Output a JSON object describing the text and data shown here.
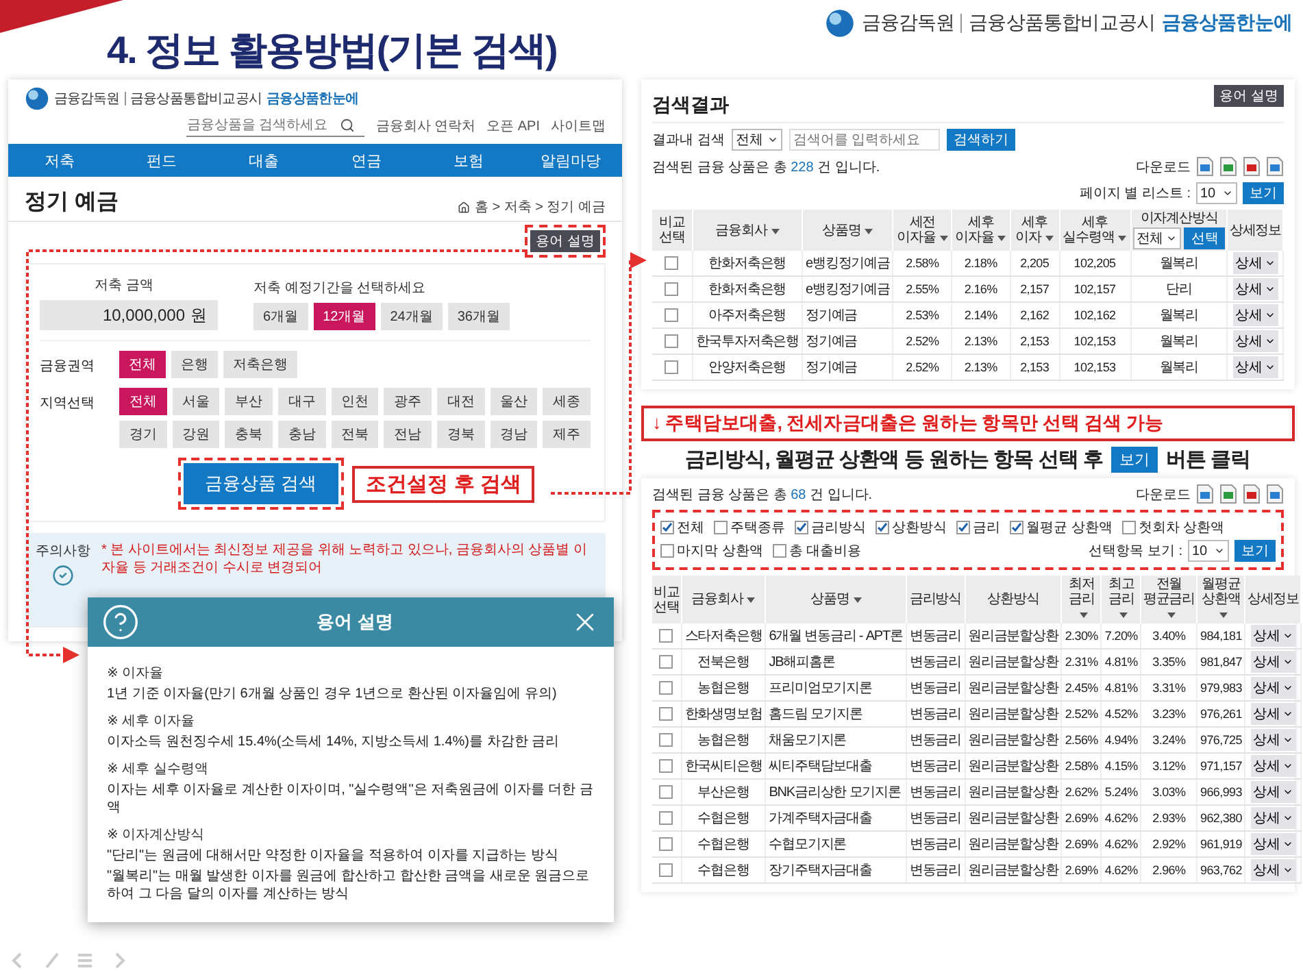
{
  "slide": {
    "title": "4. 정보 활용방법(기본 검색)"
  },
  "brand": {
    "agency": "금융감독원",
    "service": "금융상품통합비교공시",
    "site": "금융상품한눈에"
  },
  "page": {
    "brand": {
      "agency": "금융감독원",
      "service": "금융상품통합비교공시",
      "site": "금융상품한눈에"
    },
    "search": {
      "placeholder": "금융상품을 검색하세요"
    },
    "links": [
      "금융회사 연락처",
      "오픈 API",
      "사이트맵"
    ],
    "nav": [
      "저축",
      "펀드",
      "대출",
      "연금",
      "보험",
      "알림마당"
    ],
    "title": "정기 예금",
    "breadcrumb": "홈 > 저축 > 정기 예금",
    "glossary_button": {
      "label": "용어 설명",
      "highlighted": true
    },
    "amount": {
      "label": "저축 금액",
      "value": "10,000,000",
      "unit": "원"
    },
    "period": {
      "label": "저축 예정기간을 선택하세요",
      "options": [
        {
          "label": "6개월",
          "selected": false
        },
        {
          "label": "12개월",
          "selected": true
        },
        {
          "label": "24개월",
          "selected": false
        },
        {
          "label": "36개월",
          "selected": false
        }
      ]
    },
    "sector": {
      "label": "금융권역",
      "options": [
        {
          "label": "전체",
          "selected": true
        },
        {
          "label": "은행",
          "selected": false
        },
        {
          "label": "저축은행",
          "selected": false
        }
      ]
    },
    "region": {
      "label": "지역선택",
      "options": [
        {
          "label": "전체",
          "selected": true
        },
        {
          "label": "서울",
          "selected": false
        },
        {
          "label": "부산",
          "selected": false
        },
        {
          "label": "대구",
          "selected": false
        },
        {
          "label": "인천",
          "selected": false
        },
        {
          "label": "광주",
          "selected": false
        },
        {
          "label": "대전",
          "selected": false
        },
        {
          "label": "울산",
          "selected": false
        },
        {
          "label": "세종",
          "selected": false
        },
        {
          "label": "경기",
          "selected": false
        },
        {
          "label": "강원",
          "selected": false
        },
        {
          "label": "충북",
          "selected": false
        },
        {
          "label": "충남",
          "selected": false
        },
        {
          "label": "전북",
          "selected": false
        },
        {
          "label": "전남",
          "selected": false
        },
        {
          "label": "경북",
          "selected": false
        },
        {
          "label": "경남",
          "selected": false
        },
        {
          "label": "제주",
          "selected": false
        }
      ]
    },
    "search_button": {
      "label": "금융상품 검색",
      "highlighted": true
    },
    "notice": {
      "label": "주의사항",
      "text": "* 본 사이트에서는 최신정보 제공을 위해 노력하고 있으나, 금융회사의 상품별 이자율 등 거래조건이 수시로 변경되어"
    }
  },
  "search_callout": "조건설정 후 검색",
  "glossary_dialog": {
    "title": "용어 설명",
    "sections": [
      {
        "heading": "※ 이자율",
        "lines": [
          "1년 기준 이자율(만기 6개월 상품인 경우 1년으로 환산된 이자율임에 유의)"
        ]
      },
      {
        "heading": "※ 세후 이자율",
        "lines": [
          "이자소득 원천징수세 15.4%(소득세 14%, 지방소득세 1.4%)를 차감한 금리"
        ]
      },
      {
        "heading": "※ 세후 실수령액",
        "lines": [
          "이자는 세후 이자율로 계산한 이자이며, \"실수령액\"은 저축원금에 이자를 더한 금액"
        ]
      },
      {
        "heading": "※ 이자계산방식",
        "lines": [
          "\"단리\"는 원금에 대해서만 약정한 이자율을 적용하여 이자를 지급하는 방식",
          "\"월복리\"는 매월 발생한 이자를 원금에 합산하고 합산한 금액을 새로운 원금으로 하여 그 다음 달의 이자를 계산하는 방식"
        ]
      }
    ]
  },
  "results": {
    "title": "검색결과",
    "glossary_button": "용어 설명",
    "filter_label": "결과내 검색",
    "scope": "전체",
    "placeholder": "검색어를 입력하세요",
    "search_button": "검색하기",
    "count": {
      "before": "검색된 금융 상품은 총",
      "number": "228",
      "after": "건 입니다."
    },
    "download": "다운로드",
    "page_size": {
      "label": "페이지 별 리스트 :",
      "value": "10",
      "button": "보기"
    },
    "table": {
      "columns": [
        {
          "label": "비교 선택",
          "kind": "check",
          "sortable": false
        },
        {
          "label": "금융회사",
          "kind": "text",
          "sortable": true
        },
        {
          "label": "상품명",
          "kind": "text",
          "sortable": true
        },
        {
          "label": "세전 이자율",
          "kind": "number",
          "sortable": true
        },
        {
          "label": "세후 이자율",
          "kind": "number",
          "sortable": true
        },
        {
          "label": "세후 이자",
          "kind": "number",
          "sortable": true
        },
        {
          "label": "세후 실수령액",
          "kind": "number",
          "sortable": true
        },
        {
          "label": "이자계산방식",
          "kind": "text",
          "sortable": false,
          "filter": {
            "value": "전체",
            "button": "선택"
          }
        },
        {
          "label": "상세정보",
          "kind": "detail",
          "sortable": false
        }
      ],
      "rows": [
        {
          "checked": false,
          "cells": [
            "",
            "한화저축은행",
            "e뱅킹정기예금",
            "2.58%",
            "2.18%",
            "2,205",
            "102,205",
            "월복리",
            "상세"
          ]
        },
        {
          "checked": false,
          "cells": [
            "",
            "한화저축은행",
            "e뱅킹정기예금",
            "2.55%",
            "2.16%",
            "2,157",
            "102,157",
            "단리",
            "상세"
          ]
        },
        {
          "checked": false,
          "cells": [
            "",
            "아주저축은행",
            "정기예금",
            "2.53%",
            "2.14%",
            "2,162",
            "102,162",
            "월복리",
            "상세"
          ]
        },
        {
          "checked": false,
          "cells": [
            "",
            "한국투자저축은행",
            "정기예금",
            "2.52%",
            "2.13%",
            "2,153",
            "102,153",
            "월복리",
            "상세"
          ]
        },
        {
          "checked": false,
          "cells": [
            "",
            "안양저축은행",
            "정기예금",
            "2.52%",
            "2.13%",
            "2,153",
            "102,153",
            "월복리",
            "상세"
          ]
        }
      ]
    }
  },
  "loan_callout": "↓ 주택담보대출, 전세자금대출은 원하는 항목만 선택 검색 가능",
  "loan_hint": {
    "before": "금리방식, 월평균 상환액 등 원하는 항목 선택 후",
    "button": "보기",
    "after": "버튼 클릭"
  },
  "loan_results": {
    "count": {
      "before": "검색된 금융 상품은 총",
      "number": "68",
      "after": "건 입니다."
    },
    "download": "다운로드",
    "filters": {
      "highlighted": true,
      "options": [
        {
          "label": "전체",
          "checked": true
        },
        {
          "label": "주택종류",
          "checked": false
        },
        {
          "label": "금리방식",
          "checked": true
        },
        {
          "label": "상환방식",
          "checked": true
        },
        {
          "label": "금리",
          "checked": true
        },
        {
          "label": "월평균 상환액",
          "checked": true
        },
        {
          "label": "첫회차 상환액",
          "checked": false
        },
        {
          "label": "마지막 상환액",
          "checked": false
        },
        {
          "label": "총 대출비용",
          "checked": false
        }
      ],
      "page_size": {
        "label": "선택항목 보기 :",
        "value": "10",
        "button": "보기"
      }
    },
    "table": {
      "columns": [
        {
          "label": "비교 선택",
          "kind": "check",
          "sortable": false
        },
        {
          "label": "금융회사",
          "kind": "text",
          "sortable": true
        },
        {
          "label": "상품명",
          "kind": "text",
          "sortable": true
        },
        {
          "label": "금리방식",
          "kind": "text",
          "sortable": false
        },
        {
          "label": "상환방식",
          "kind": "text",
          "sortable": false
        },
        {
          "label": "최저 금리",
          "kind": "number",
          "sortable": true
        },
        {
          "label": "최고 금리",
          "kind": "number",
          "sortable": true
        },
        {
          "label": "전월 평균금리",
          "kind": "number",
          "sortable": true
        },
        {
          "label": "월평균 상환액",
          "kind": "number",
          "sortable": true
        },
        {
          "label": "상세정보",
          "kind": "detail",
          "sortable": false
        }
      ],
      "rows": [
        {
          "checked": false,
          "cells": [
            "",
            "스타저축은행",
            "6개월 변동금리 - APT론",
            "변동금리",
            "원리금분할상환",
            "2.30%",
            "7.20%",
            "3.40%",
            "984,181",
            "상세"
          ]
        },
        {
          "checked": false,
          "cells": [
            "",
            "전북은행",
            "JB해피홈론",
            "변동금리",
            "원리금분할상환",
            "2.31%",
            "4.81%",
            "3.35%",
            "981,847",
            "상세"
          ]
        },
        {
          "checked": false,
          "cells": [
            "",
            "농협은행",
            "프리미엄모기지론",
            "변동금리",
            "원리금분할상환",
            "2.45%",
            "4.81%",
            "3.31%",
            "979,983",
            "상세"
          ]
        },
        {
          "checked": false,
          "cells": [
            "",
            "한화생명보험",
            "홈드림 모기지론",
            "변동금리",
            "원리금분할상환",
            "2.52%",
            "4.52%",
            "3.23%",
            "976,261",
            "상세"
          ]
        },
        {
          "checked": false,
          "cells": [
            "",
            "농협은행",
            "채움모기지론",
            "변동금리",
            "원리금분할상환",
            "2.56%",
            "4.94%",
            "3.24%",
            "976,725",
            "상세"
          ]
        },
        {
          "checked": false,
          "cells": [
            "",
            "한국씨티은행",
            "씨티주택담보대출",
            "변동금리",
            "원리금분할상환",
            "2.58%",
            "4.15%",
            "3.12%",
            "971,157",
            "상세"
          ]
        },
        {
          "checked": false,
          "cells": [
            "",
            "부산은행",
            "BNK금리상한 모기지론",
            "변동금리",
            "원리금분할상환",
            "2.62%",
            "5.24%",
            "3.03%",
            "966,993",
            "상세"
          ]
        },
        {
          "checked": false,
          "cells": [
            "",
            "수협은행",
            "가계주택자금대출",
            "변동금리",
            "원리금분할상환",
            "2.69%",
            "4.62%",
            "2.93%",
            "962,380",
            "상세"
          ]
        },
        {
          "checked": false,
          "cells": [
            "",
            "수협은행",
            "수협모기지론",
            "변동금리",
            "원리금분할상환",
            "2.69%",
            "4.62%",
            "2.92%",
            "961,919",
            "상세"
          ]
        },
        {
          "checked": false,
          "cells": [
            "",
            "수협은행",
            "장기주택자금대출",
            "변동금리",
            "원리금분할상환",
            "2.69%",
            "4.62%",
            "2.96%",
            "963,762",
            "상세"
          ]
        }
      ]
    }
  }
}
